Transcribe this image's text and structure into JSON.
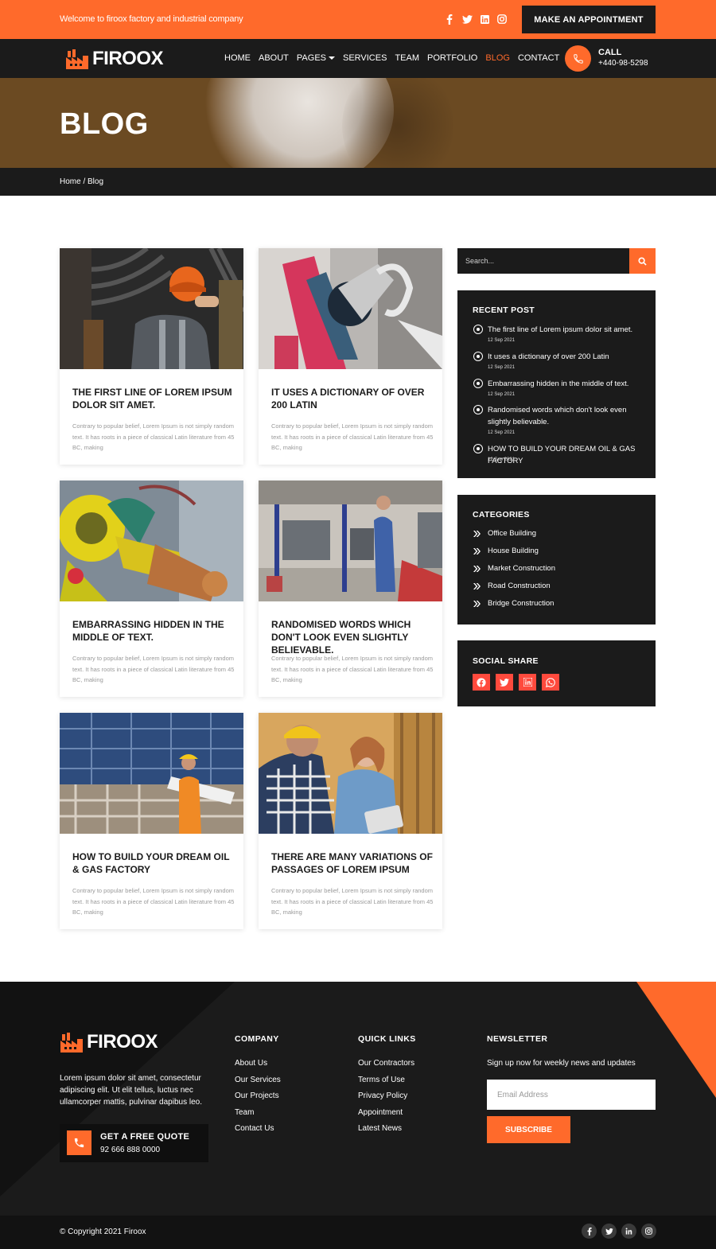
{
  "topbar": {
    "welcome": "Welcome to firoox factory and industrial company",
    "socials": [
      "facebook-icon",
      "twitter-icon",
      "linkedin-icon",
      "instagram-icon"
    ],
    "appointment_label": "MAKE AN APPOINTMENT"
  },
  "brand": {
    "name": "FIROOX",
    "accent": "#ff6a2b",
    "dark": "#1b1b1b"
  },
  "nav": {
    "items": [
      {
        "label": "HOME"
      },
      {
        "label": "ABOUT"
      },
      {
        "label": "PAGES"
      },
      {
        "label": "SERVICES"
      },
      {
        "label": "TEAM"
      },
      {
        "label": "PORTFOLIO"
      },
      {
        "label": "BLOG"
      },
      {
        "label": "CONTACT"
      }
    ],
    "active": "BLOG",
    "call_label": "CALL",
    "call_number": "+440-98-5298"
  },
  "hero": {
    "title": "BLOG",
    "breadcrumb": "Home / Blog"
  },
  "posts": [
    {
      "title": "THE FIRST LINE OF LOREM IPSUM DOLOR SIT AMET.",
      "excerpt": "Contrary to popular belief, Lorem Ipsum is not simply random text. It has roots in a piece of classical Latin literature from 45 BC, making"
    },
    {
      "title": "IT USES A DICTIONARY OF OVER 200 LATIN",
      "excerpt": "Contrary to popular belief, Lorem Ipsum is not simply random text. It has roots in a piece of classical Latin literature from 45 BC, making"
    },
    {
      "title": "EMBARRASSING HIDDEN IN THE MIDDLE OF TEXT.",
      "excerpt": "Contrary to popular belief, Lorem Ipsum is not simply random text. It has roots in a piece of classical Latin literature from 45 BC, making"
    },
    {
      "title": "RANDOMISED WORDS WHICH DON'T LOOK EVEN SLIGHTLY BELIEVABLE.",
      "excerpt": "Contrary to popular belief, Lorem Ipsum is not simply random text. It has roots in a piece of classical Latin literature from 45 BC, making"
    },
    {
      "title": "HOW TO BUILD YOUR DREAM OIL & GAS FACTORY",
      "excerpt": "Contrary to popular belief, Lorem Ipsum is not simply random text. It has roots in a piece of classical Latin literature from 45 BC, making"
    },
    {
      "title": "THERE ARE MANY VARIATIONS OF PASSAGES OF LOREM IPSUM",
      "excerpt": "Contrary to popular belief, Lorem Ipsum is not simply random text. It has roots in a piece of classical Latin literature from 45 BC, making"
    }
  ],
  "sidebar": {
    "search_placeholder": "Search...",
    "recent_title": "RECENT POST",
    "recent": [
      {
        "title": "The first line of Lorem ipsum dolor sit amet.",
        "date": "12 Sep 2021"
      },
      {
        "title": "It uses a dictionary of over 200 Latin",
        "date": "12 Sep 2021"
      },
      {
        "title": "Embarrassing hidden in the middle of text.",
        "date": "12 Sep 2021"
      },
      {
        "title": "Randomised words which don't look even slightly believable.",
        "date": "12 Sep 2021"
      },
      {
        "title": "HOW TO BUILD YOUR DREAM OIL & GAS FACTORY",
        "date": "12 Sep 2021"
      }
    ],
    "categories_title": "CATEGORIES",
    "categories": [
      "Office Building",
      "House Building",
      "Market Construction",
      "Road Construction",
      "Bridge Construction"
    ],
    "share_title": "SOCIAL SHARE",
    "share_icons": [
      "facebook-icon",
      "twitter-icon",
      "linkedin-icon",
      "whatsapp-icon"
    ]
  },
  "footer": {
    "about": "Lorem ipsum dolor sit amet, consectetur adipiscing elit. Ut elit tellus, luctus nec ullamcorper mattis, pulvinar dapibus leo.",
    "quote_label": "GET A FREE QUOTE",
    "quote_phone": "92 666 888 0000",
    "company_title": "COMPANY",
    "company_links": [
      "About Us",
      "Our Services",
      "Our Projects",
      "Team",
      "Contact Us"
    ],
    "quick_title": "QUICK LINKS",
    "quick_links": [
      "Our Contractors",
      "Terms of Use",
      "Privacy Policy",
      "Appointment",
      "Latest News"
    ],
    "newsletter_title": "NEWSLETTER",
    "newsletter_text": "Sign up now for weekly news and updates",
    "email_placeholder": "Email Address",
    "subscribe_label": "SUBSCRIBE",
    "copyright": "© Copyright 2021 Firoox",
    "bottom_socials": [
      "facebook-icon",
      "twitter-icon",
      "linkedin-icon",
      "instagram-icon"
    ]
  }
}
